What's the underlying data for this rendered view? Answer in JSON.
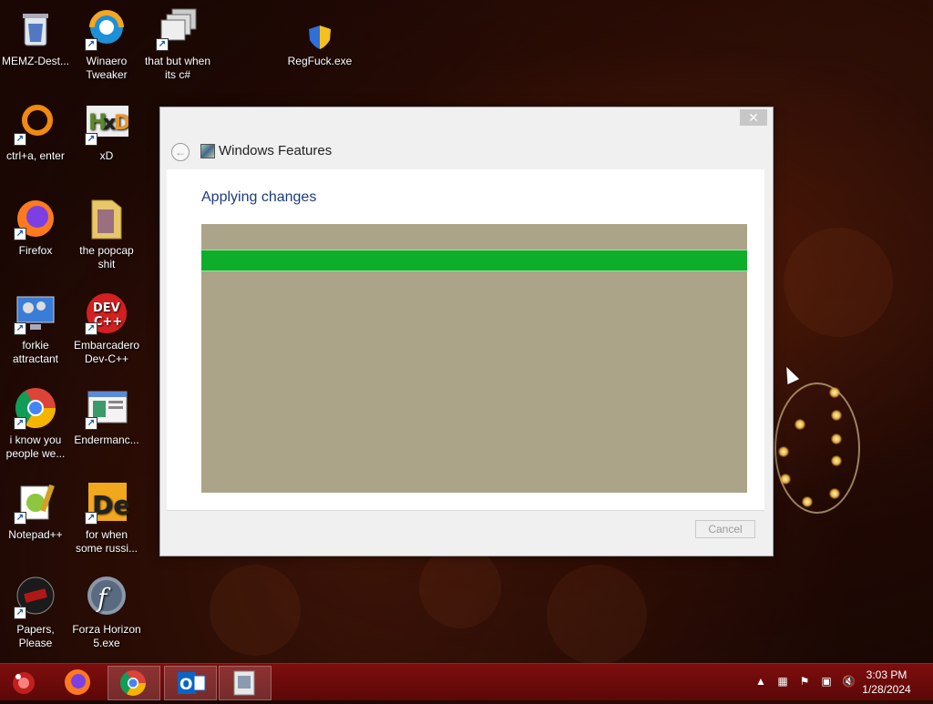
{
  "desktop": {
    "icons": [
      {
        "label": "MEMZ-Dest..."
      },
      {
        "label": "Winaero\nTweaker"
      },
      {
        "label": "that but when\nits c#"
      },
      {
        "label": "RegFuck.exe"
      },
      {
        "label": "ctrl+a, enter"
      },
      {
        "label": "xD"
      },
      {
        "label": "Firefox"
      },
      {
        "label": "the popcap\nshit"
      },
      {
        "label": "forkie\nattractant"
      },
      {
        "label": "Embarcadero\nDev-C++"
      },
      {
        "label": "i know you\npeople we..."
      },
      {
        "label": "Endermanc..."
      },
      {
        "label": "Notepad++"
      },
      {
        "label": "for when\nsome russi..."
      },
      {
        "label": "Papers, Please"
      },
      {
        "label": "Forza Horizon\n5.exe"
      }
    ]
  },
  "window": {
    "title": "Windows Features",
    "close_glyph": "✕",
    "back_glyph": "←",
    "heading": "Applying changes",
    "cancel_label": "Cancel",
    "progress_fraction": 1.0
  },
  "taskbar": {
    "clock_time": "3:03 PM",
    "clock_date": "1/28/2024"
  },
  "icons": {
    "recycle_bin": "recycle-bin-icon",
    "shield": "uac-shield-icon",
    "flag": "action-center-flag-icon",
    "network": "network-icon",
    "volume": "volume-muted-icon"
  },
  "colors": {
    "progress_fill": "#0fae2a",
    "progress_bg": "#aba488",
    "heading": "#1e3c78",
    "taskbar": "#6b0a0a"
  }
}
